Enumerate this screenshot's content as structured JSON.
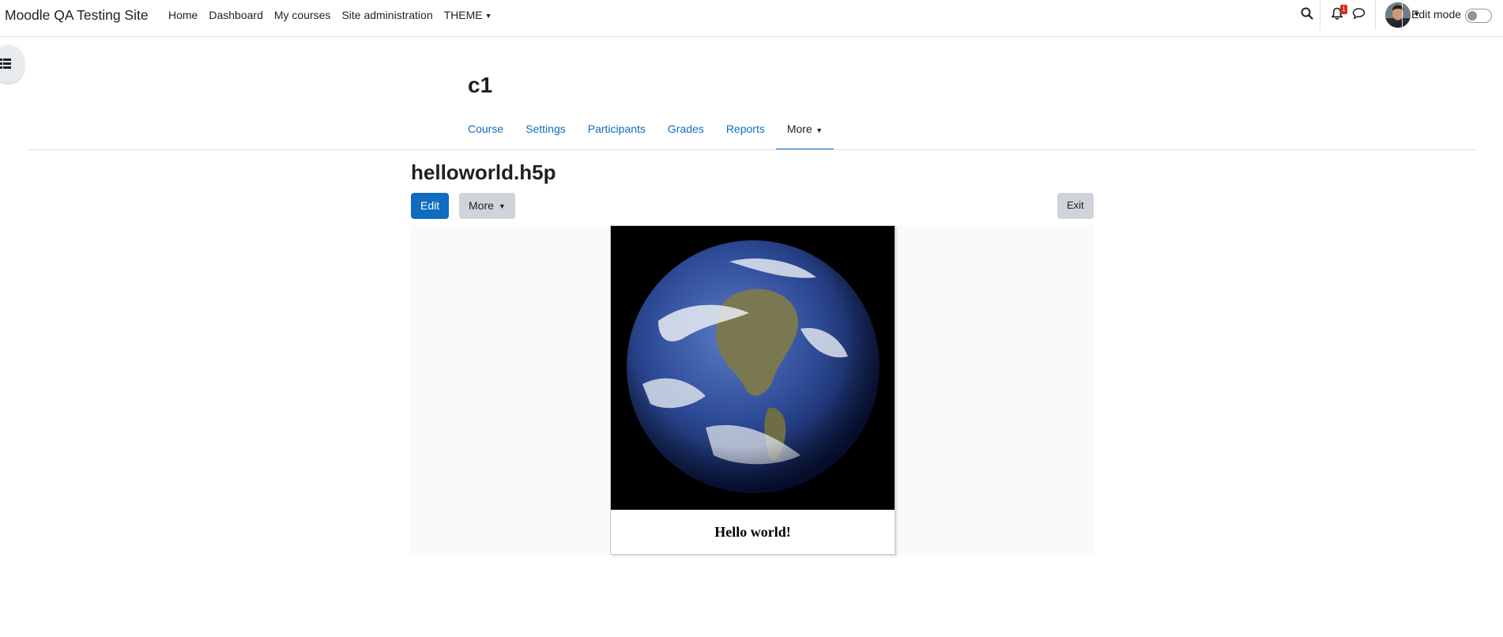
{
  "navbar": {
    "brand": "Moodle QA Testing Site",
    "links": [
      "Home",
      "Dashboard",
      "My courses",
      "Site administration",
      "THEME"
    ],
    "notifications_count": "1",
    "edit_mode_label": "Edit mode"
  },
  "course": {
    "title": "c1",
    "tabs": [
      "Course",
      "Settings",
      "Participants",
      "Grades",
      "Reports",
      "More"
    ],
    "active_tab": "More"
  },
  "page": {
    "heading": "helloworld.h5p",
    "edit_label": "Edit",
    "more_label": "More",
    "exit_label": "Exit"
  },
  "h5p": {
    "image_icon": "earth-image",
    "caption": "Hello world!"
  },
  "colors": {
    "primary": "#0f6cbf",
    "badge": "#ca3120",
    "secondary_button": "#ced4da"
  }
}
